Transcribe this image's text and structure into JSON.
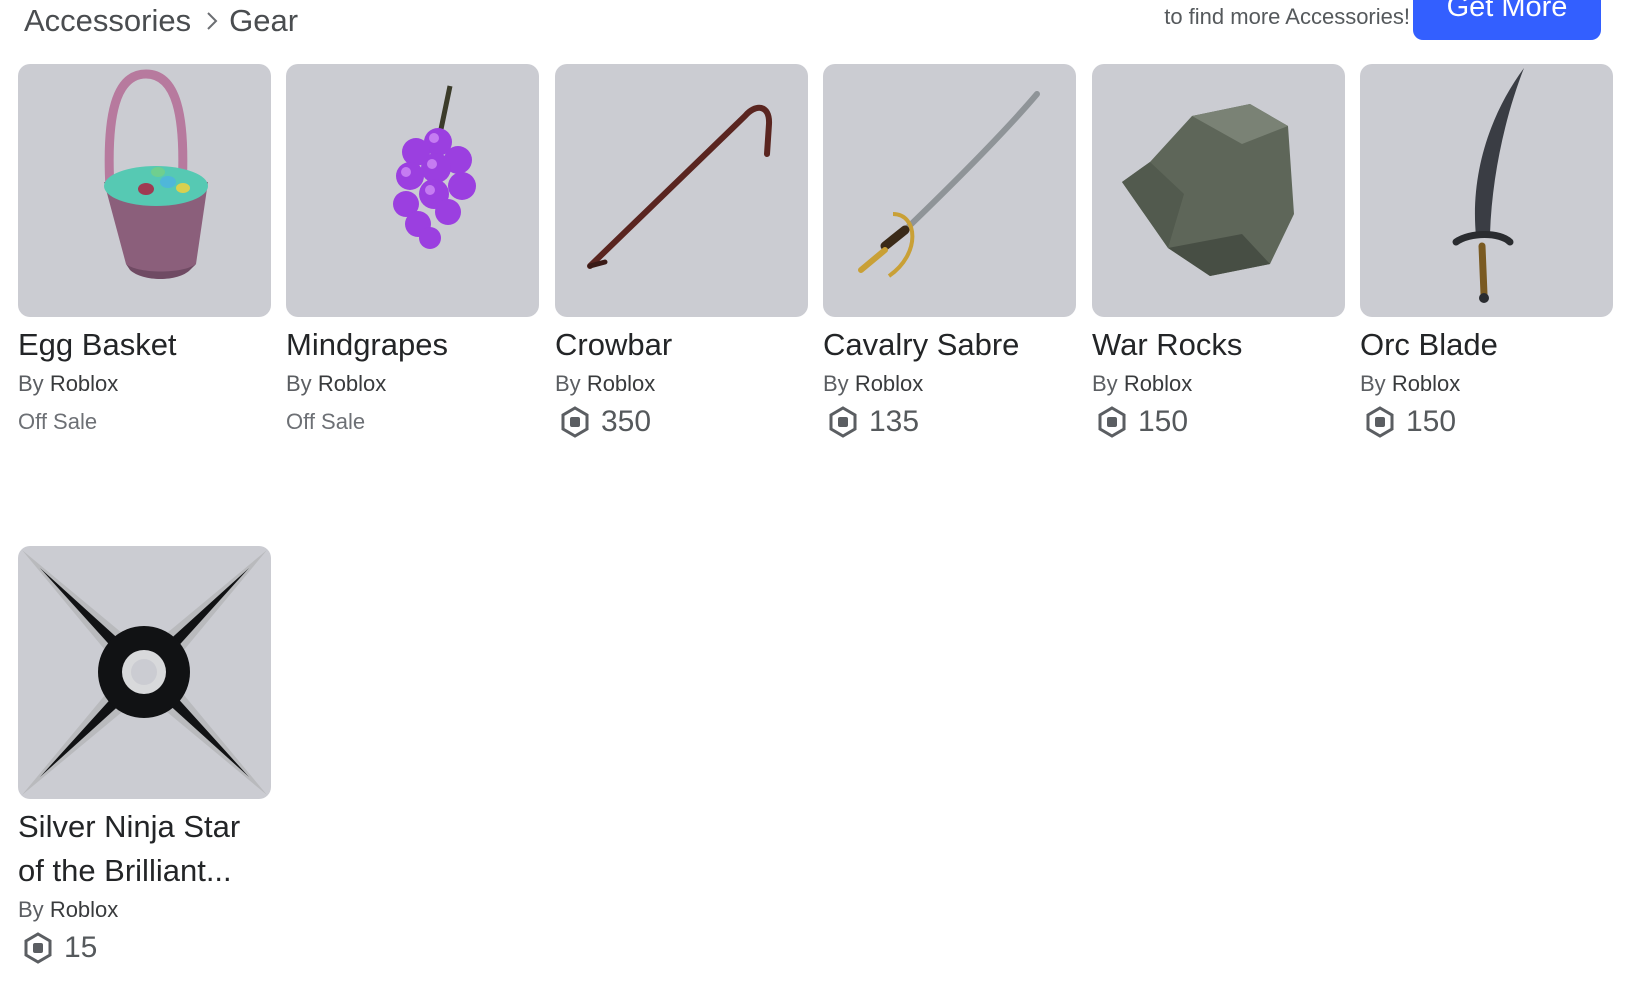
{
  "breadcrumb": {
    "parent": "Accessories",
    "current": "Gear"
  },
  "promo": {
    "text": "to find more Accessories!",
    "button_label": "Get More"
  },
  "colors": {
    "accent": "#335fff",
    "thumb_bg": "#cbccd2"
  },
  "items": [
    {
      "name": "Egg Basket",
      "by_prefix": "By",
      "creator": "Roblox",
      "status": "Off Sale",
      "price": null,
      "icon": "egg-basket"
    },
    {
      "name": "Mindgrapes",
      "by_prefix": "By",
      "creator": "Roblox",
      "status": "Off Sale",
      "price": null,
      "icon": "mindgrapes"
    },
    {
      "name": "Crowbar",
      "by_prefix": "By",
      "creator": "Roblox",
      "status": null,
      "price": "350",
      "icon": "crowbar"
    },
    {
      "name": "Cavalry Sabre",
      "by_prefix": "By",
      "creator": "Roblox",
      "status": null,
      "price": "135",
      "icon": "cavalry-sabre"
    },
    {
      "name": "War Rocks",
      "by_prefix": "By",
      "creator": "Roblox",
      "status": null,
      "price": "150",
      "icon": "war-rocks"
    },
    {
      "name": "Orc Blade",
      "by_prefix": "By",
      "creator": "Roblox",
      "status": null,
      "price": "150",
      "icon": "orc-blade"
    },
    {
      "name": "Silver Ninja Star of the Brilliant...",
      "name_line1": "Silver Ninja Star",
      "name_line2": "of the Brilliant...",
      "by_prefix": "By",
      "creator": "Roblox",
      "status": null,
      "price": "15",
      "icon": "ninja-star"
    }
  ]
}
